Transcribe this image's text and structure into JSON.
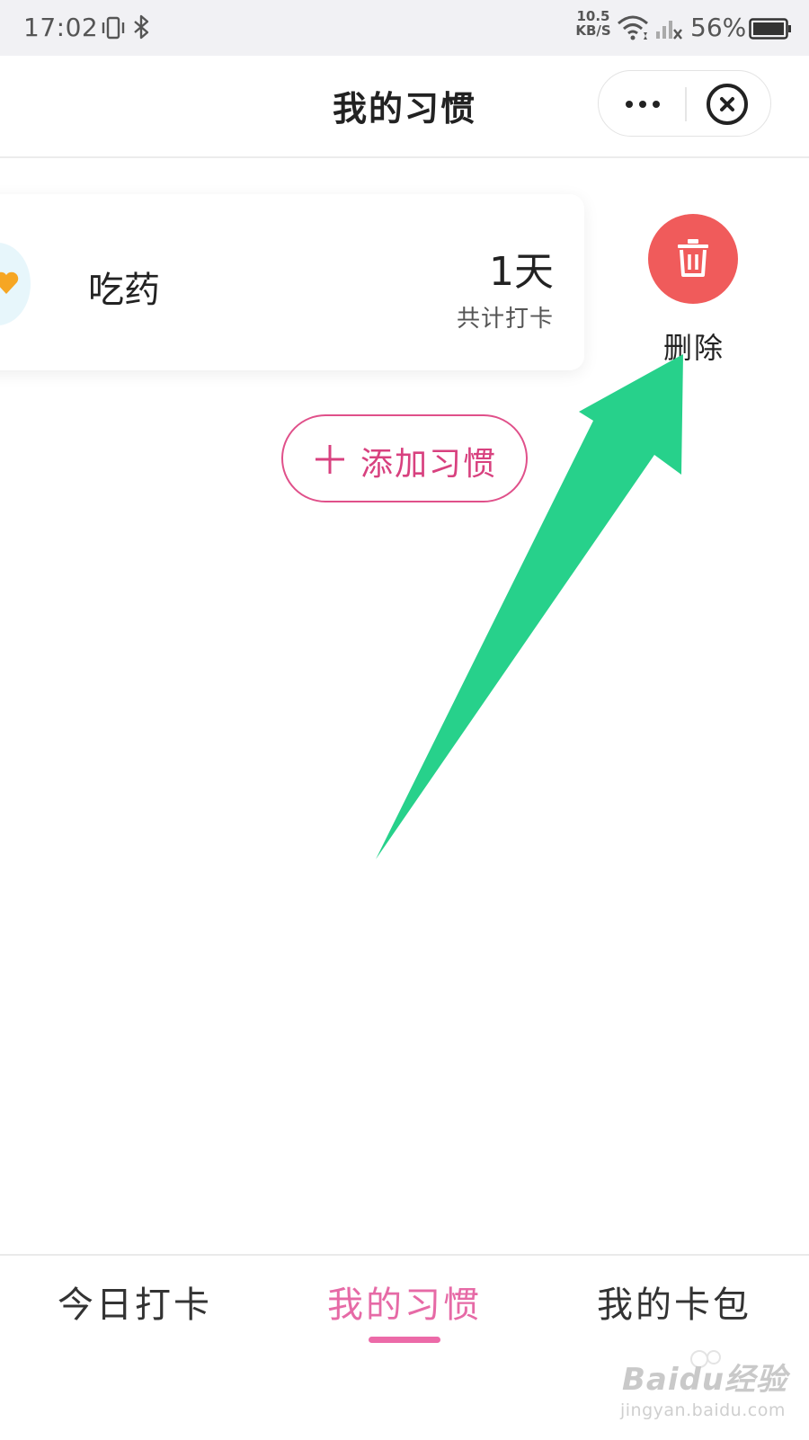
{
  "status_bar": {
    "time": "17:02",
    "net_speed_value": "10.5",
    "net_speed_unit": "KB/S",
    "battery_percent": "56%"
  },
  "nav": {
    "title": "我的习惯"
  },
  "habit": {
    "name": "吃药",
    "count": "1天",
    "count_label": "共计打卡"
  },
  "actions": {
    "delete_label": "删除",
    "add_label": "添加习惯"
  },
  "tabs": [
    {
      "label": "今日打卡",
      "active": false
    },
    {
      "label": "我的习惯",
      "active": true
    },
    {
      "label": "我的卡包",
      "active": false
    }
  ],
  "watermark": {
    "brand": "Baidu经验",
    "url": "jingyan.baidu.com"
  },
  "colors": {
    "accent_pink": "#e66aa6",
    "delete_red": "#f05b5b",
    "arrow_green": "#27d18b"
  },
  "icons": {
    "delete": "trash-icon",
    "add": "plus-icon",
    "more": "more-dots-icon",
    "close": "close-circle-icon"
  }
}
